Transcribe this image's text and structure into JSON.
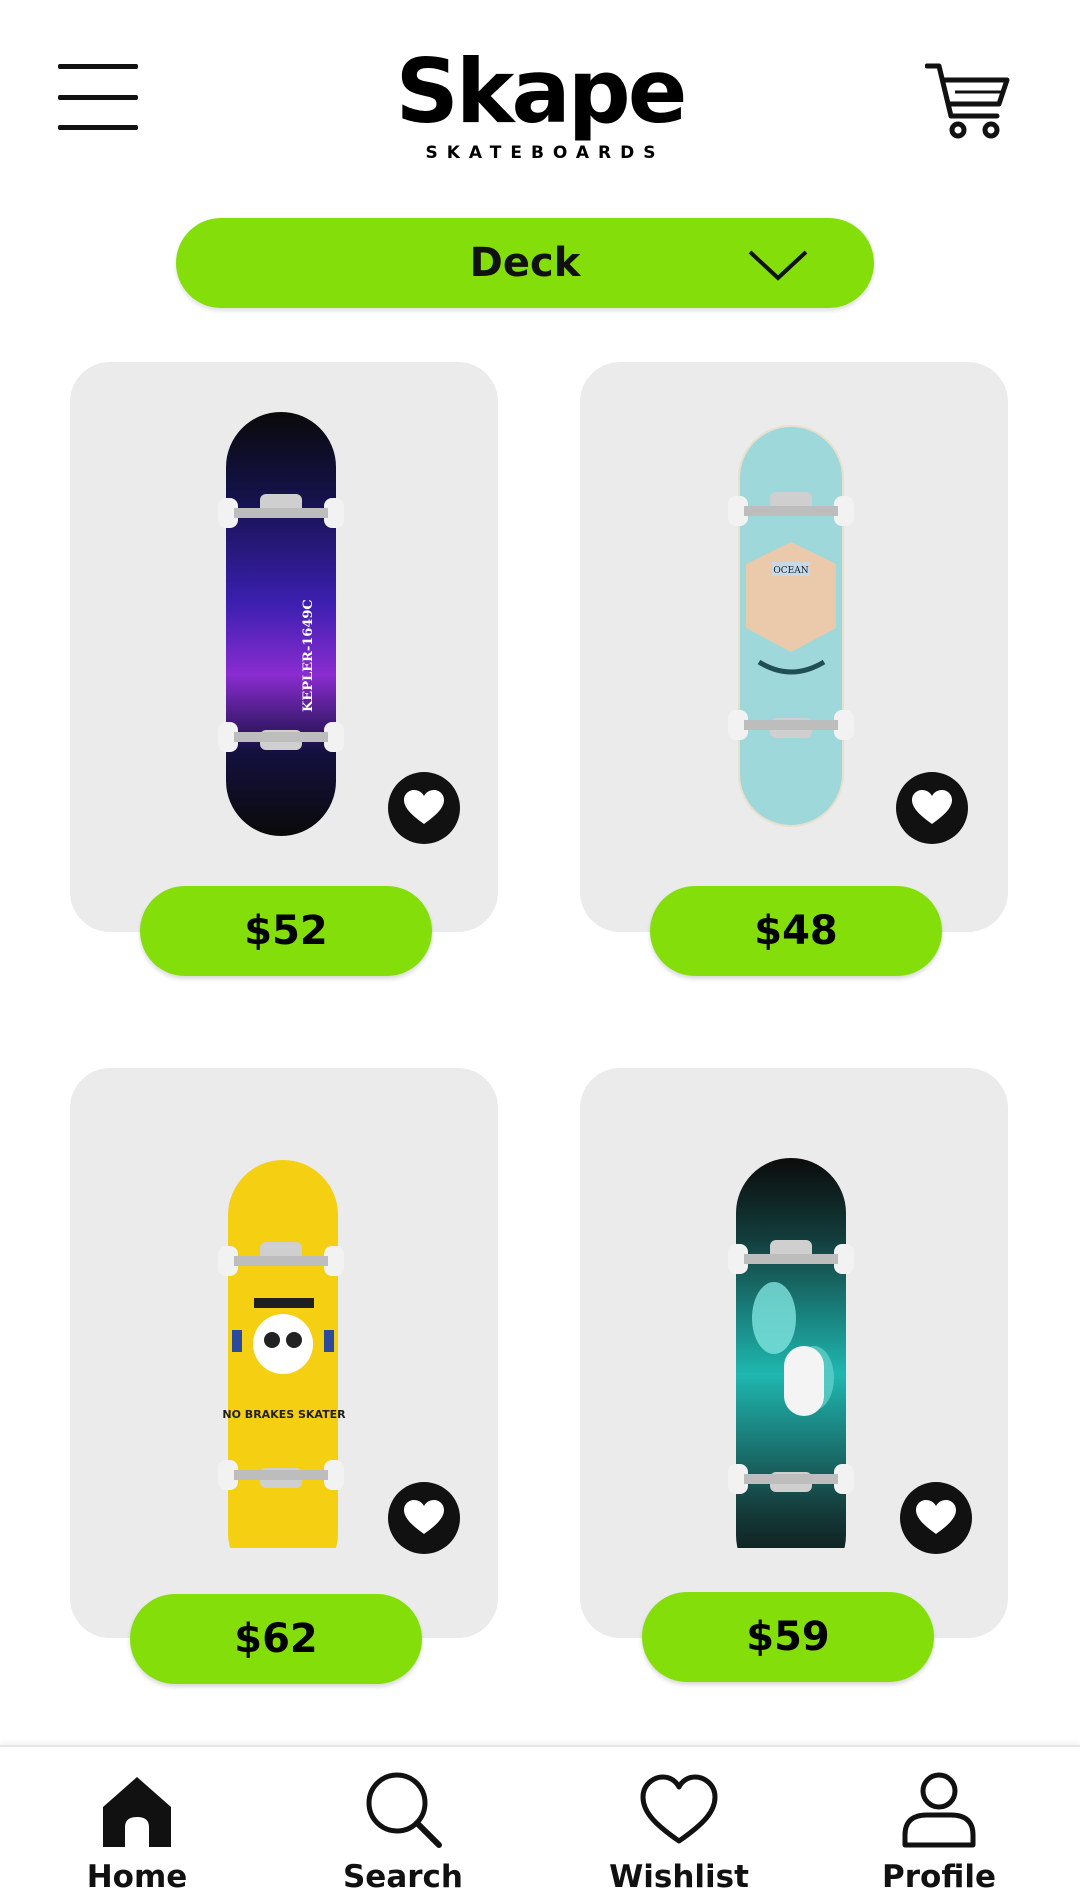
{
  "header": {
    "menu_icon": "hamburger-menu-icon",
    "brand_name": "Skape",
    "brand_tagline": "SKATEBOARDS",
    "cart_icon": "shopping-cart-icon"
  },
  "filter": {
    "selected": "Deck",
    "icon": "chevron-down-icon"
  },
  "products": [
    {
      "price": "$52",
      "deck_text": "KEPLER-1649C",
      "favorite_icon": "heart-icon"
    },
    {
      "price": "$48",
      "deck_text": "OCEAN",
      "favorite_icon": "heart-icon"
    },
    {
      "price": "$62",
      "deck_text": "NO BRAKES SKATER",
      "favorite_icon": "heart-icon"
    },
    {
      "price": "$59",
      "deck_text": "",
      "favorite_icon": "heart-icon"
    }
  ],
  "bottom_nav": [
    {
      "label": "Home",
      "icon": "home-icon"
    },
    {
      "label": "Search",
      "icon": "search-icon"
    },
    {
      "label": "Wishlist",
      "icon": "heart-outline-icon"
    },
    {
      "label": "Profile",
      "icon": "user-icon"
    }
  ],
  "colors": {
    "accent": "#84de09",
    "card_bg": "#ebebeb",
    "text": "#111111"
  }
}
